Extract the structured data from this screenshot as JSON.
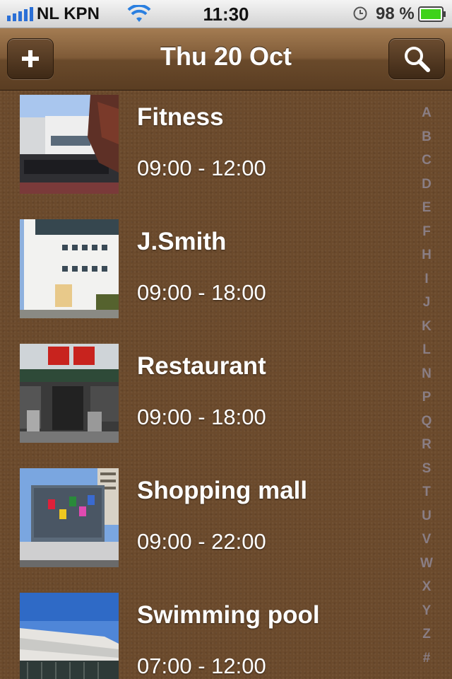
{
  "status_bar": {
    "carrier": "NL KPN",
    "time": "11:30",
    "battery_percent": "98 %"
  },
  "nav": {
    "title": "Thu 20 Oct",
    "add_icon": "plus-icon",
    "search_icon": "magnifier-icon"
  },
  "items": [
    {
      "title": "Fitness",
      "hours": "09:00 - 12:00"
    },
    {
      "title": "J.Smith",
      "hours": "09:00 - 18:00"
    },
    {
      "title": "Restaurant",
      "hours": "09:00 - 18:00"
    },
    {
      "title": "Shopping mall",
      "hours": "09:00 - 22:00"
    },
    {
      "title": "Swimming pool",
      "hours": "07:00 - 12:00"
    }
  ],
  "index": [
    "A",
    "B",
    "C",
    "D",
    "E",
    "F",
    "H",
    "I",
    "J",
    "K",
    "L",
    "N",
    "P",
    "Q",
    "R",
    "S",
    "T",
    "U",
    "V",
    "W",
    "X",
    "Y",
    "Z",
    "#"
  ],
  "colors": {
    "background": "#6b4a2c",
    "battery_green": "#3fd21a",
    "wifi_blue": "#2a7fe0",
    "index_gray": "#8a7e84"
  }
}
